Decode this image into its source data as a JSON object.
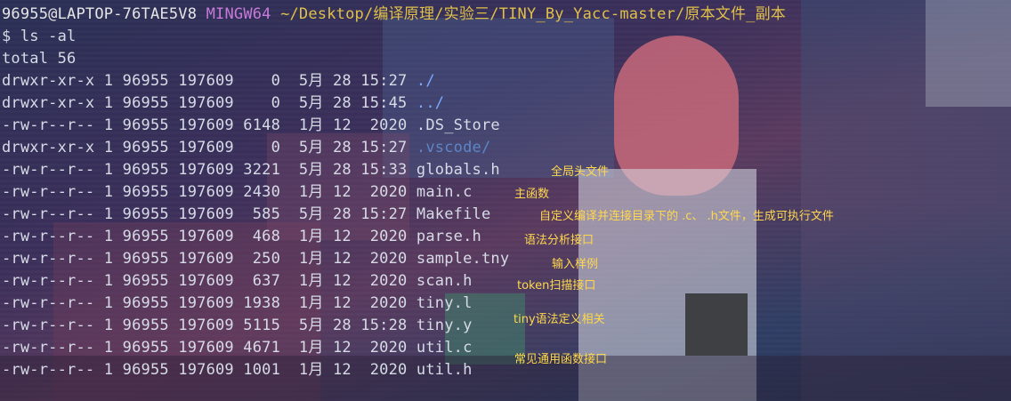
{
  "prompt": {
    "user_host": "96955@LAPTOP-76TAE5V8",
    "system": "MINGW64",
    "path": "~/Desktop/编译原理/实验三/TINY_By_Yacc-master/原本文件_副本"
  },
  "command": "$ ls -al",
  "total": "total 56",
  "entries": [
    {
      "text": "drwxr-xr-x 1 96955 197609    0  5月 28 15:27 ",
      "name": "./",
      "type": "dir"
    },
    {
      "text": "drwxr-xr-x 1 96955 197609    0  5月 28 15:45 ",
      "name": "../",
      "type": "dir"
    },
    {
      "text": "-rw-r--r-- 1 96955 197609 6148  1月 12  2020 ",
      "name": ".DS_Store",
      "type": "file"
    },
    {
      "text": "drwxr-xr-x 1 96955 197609    0  5月 28 15:27 ",
      "name": ".vscode/",
      "type": "hidden-dir"
    },
    {
      "text": "-rw-r--r-- 1 96955 197609 3221  5月 28 15:33 ",
      "name": "globals.h",
      "type": "file"
    },
    {
      "text": "-rw-r--r-- 1 96955 197609 2430  1月 12  2020 ",
      "name": "main.c",
      "type": "file"
    },
    {
      "text": "-rw-r--r-- 1 96955 197609  585  5月 28 15:27 ",
      "name": "Makefile",
      "type": "file"
    },
    {
      "text": "-rw-r--r-- 1 96955 197609  468  1月 12  2020 ",
      "name": "parse.h",
      "type": "file"
    },
    {
      "text": "-rw-r--r-- 1 96955 197609  250  1月 12  2020 ",
      "name": "sample.tny",
      "type": "file"
    },
    {
      "text": "-rw-r--r-- 1 96955 197609  637  1月 12  2020 ",
      "name": "scan.h",
      "type": "file"
    },
    {
      "text": "-rw-r--r-- 1 96955 197609 1938  1月 12  2020 ",
      "name": "tiny.l",
      "type": "file"
    },
    {
      "text": "-rw-r--r-- 1 96955 197609 5115  5月 28 15:28 ",
      "name": "tiny.y",
      "type": "file"
    },
    {
      "text": "-rw-r--r-- 1 96955 197609 4671  1月 12  2020 ",
      "name": "util.c",
      "type": "file"
    },
    {
      "text": "-rw-r--r-- 1 96955 197609 1001  1月 12  2020 ",
      "name": "util.h",
      "type": "file"
    }
  ],
  "annotations": [
    "全局头文件",
    "主函数",
    "自定义编译并连接目录下的 .c、 .h文件，生成可执行文件",
    "语法分析接口",
    "输入样例",
    "token扫描接口",
    "tiny语法定义相关",
    "常见通用函数接口"
  ],
  "colors": {
    "system": "#c77ad9",
    "path": "#e0c04a",
    "directory": "#7da8ff",
    "annotation": "#ffd84d"
  }
}
